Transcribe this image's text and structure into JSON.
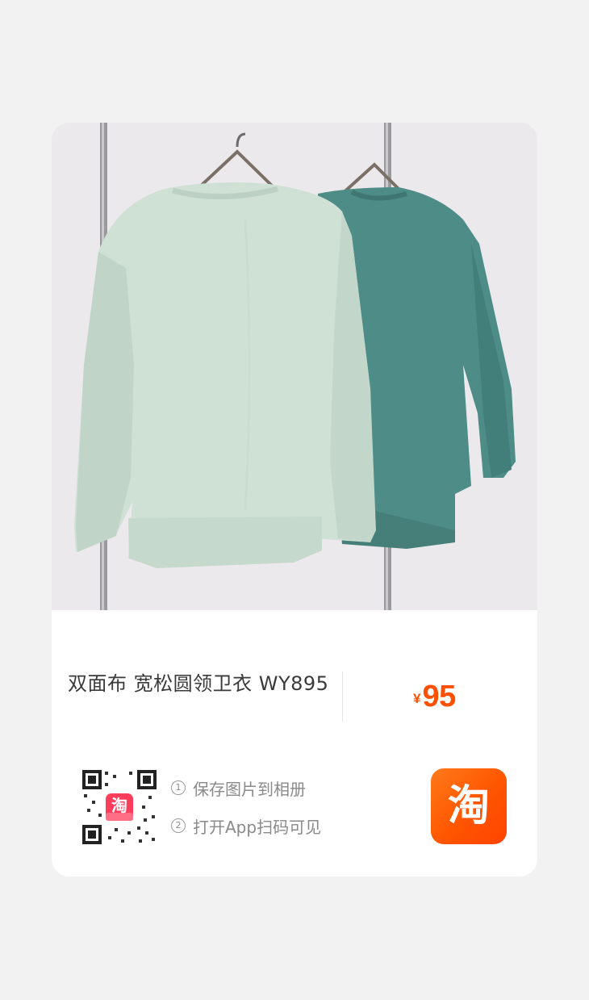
{
  "product": {
    "title": "双面布 宽松圆领卫衣 WY895",
    "currency_symbol": "¥",
    "price": "95"
  },
  "share": {
    "steps": [
      {
        "number": "1",
        "text": "保存图片到相册"
      },
      {
        "number": "2",
        "text": "打开App扫码可见"
      }
    ],
    "qr_center_glyph": "淘",
    "app_logo_glyph": "淘"
  },
  "colors": {
    "price": "#ff5000",
    "brand": "#ff5500",
    "page_background": "#f2f2f2",
    "card_background": "#ffffff"
  }
}
